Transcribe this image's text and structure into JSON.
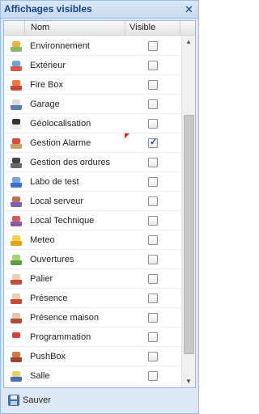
{
  "window": {
    "title": "Affichages visibles",
    "close_glyph": "✕"
  },
  "grid": {
    "columns": {
      "name": "Nom",
      "visible": "Visible"
    },
    "rows": [
      {
        "name": "Environnement",
        "visible": false,
        "icon": "environment-icon",
        "c1": "#8ab868",
        "c2": "#e9b341"
      },
      {
        "name": "Extérieur",
        "visible": false,
        "icon": "exterior-icon",
        "c1": "#d65a4a",
        "c2": "#6fa4d8"
      },
      {
        "name": "Fire Box",
        "visible": false,
        "icon": "firebox-icon",
        "c1": "#c84a3a",
        "c2": "#f07b39"
      },
      {
        "name": "Garage",
        "visible": false,
        "icon": "garage-icon",
        "c1": "#5a7fa8",
        "c2": "#d9dde3"
      },
      {
        "name": "Géolocalisation",
        "visible": false,
        "icon": "geolocation-icon",
        "c1": "#ececec",
        "c2": "#333333"
      },
      {
        "name": "Gestion Alarme",
        "visible": true,
        "icon": "alarm-icon",
        "c1": "#c8a06a",
        "c2": "#d94c3b"
      },
      {
        "name": "Gestion des ordures",
        "visible": false,
        "icon": "trash-icon",
        "c1": "#6a6a6a",
        "c2": "#444444"
      },
      {
        "name": "Labo de test",
        "visible": false,
        "icon": "lab-icon",
        "c1": "#3a6fcc",
        "c2": "#7aa1e4"
      },
      {
        "name": "Local serveur",
        "visible": false,
        "icon": "server-icon",
        "c1": "#8060b0",
        "c2": "#c07050"
      },
      {
        "name": "Local Technique",
        "visible": false,
        "icon": "technical-room-icon",
        "c1": "#8a5aa0",
        "c2": "#d06060"
      },
      {
        "name": "Meteo",
        "visible": false,
        "icon": "weather-icon",
        "c1": "#e8a020",
        "c2": "#f3d24a"
      },
      {
        "name": "Ouvertures",
        "visible": false,
        "icon": "openings-icon",
        "c1": "#5aa040",
        "c2": "#a6d07a"
      },
      {
        "name": "Palier",
        "visible": false,
        "icon": "landing-icon",
        "c1": "#c84a3a",
        "c2": "#e8d0b0"
      },
      {
        "name": "Présence",
        "visible": false,
        "icon": "presence-icon",
        "c1": "#c84a3a",
        "c2": "#e8d0b0"
      },
      {
        "name": "Présence maison",
        "visible": false,
        "icon": "home-presence-icon",
        "c1": "#b04a3a",
        "c2": "#e0c8a8"
      },
      {
        "name": "Programmation",
        "visible": false,
        "icon": "calendar-icon",
        "c1": "#ffffff",
        "c2": "#d84040"
      },
      {
        "name": "PushBox",
        "visible": false,
        "icon": "pushbox-icon",
        "c1": "#a04030",
        "c2": "#d07a4a"
      },
      {
        "name": "Salle",
        "visible": false,
        "icon": "room-icon",
        "c1": "#4a70b0",
        "c2": "#e8d070"
      }
    ],
    "dirty_row": 5
  },
  "footer": {
    "save_label": "Sauver",
    "save_icon": "floppy-disk-icon"
  }
}
